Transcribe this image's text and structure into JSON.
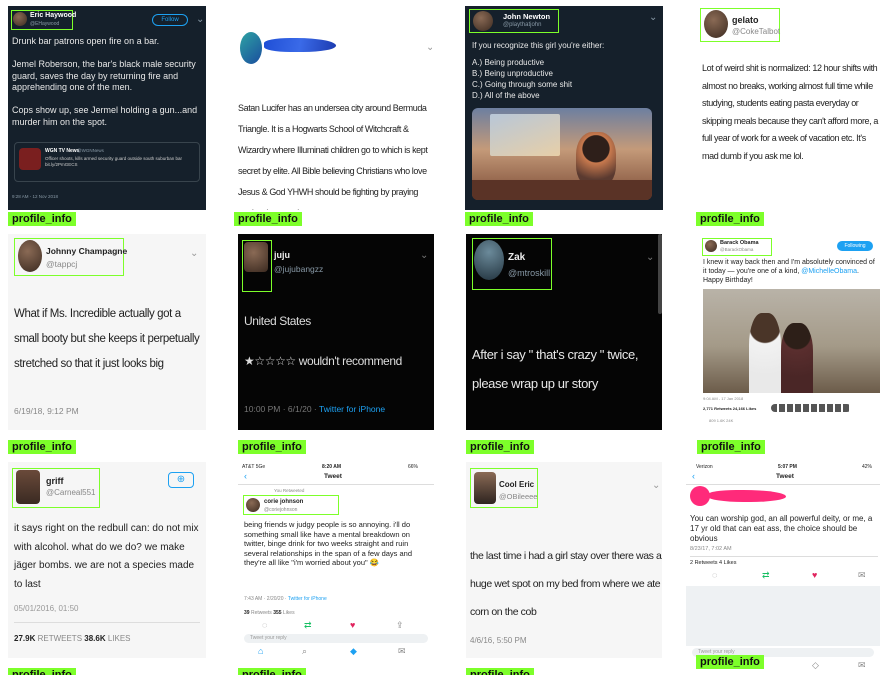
{
  "tag_label": "profile_info",
  "t1": {
    "name": "Eric Haywood",
    "handle": "@EHaywood",
    "follow": "Follow",
    "body": "Drunk bar patrons open fire on a bar.\n\nJemel Roberson, the bar's black male security guard, saves the day by returning fire and apprehending one of the men.\n\nCops show up, see Jermel holding a gun...and murder him on the spot.",
    "quote_source": "WGN TV News",
    "quote_handle": "@WGNNews",
    "quote_text": "Officer shoots, kills armed security guard outside south suburban bar bit.ly/2PmGECS",
    "time": "9:28 AM - 12 Nov 2018"
  },
  "t2": {
    "body": "Satan Lucifer has an undersea city around Bermuda Triangle. It is a Hogwarts School of Witchcraft & Wizardry where Illuminati children go to which is kept secret by elite. All Bible believing Christians who love Jesus & God YHWH should be fighting by praying against it every day."
  },
  "t3": {
    "name": "John Newton",
    "handle": "@playthatjohn",
    "body": "If you recognize this girl you're either:",
    "options": [
      "A.) Being productive",
      "B.) Being unproductive",
      "C.) Going through some shit",
      "D.) All of the above"
    ]
  },
  "t4": {
    "name": "gelato",
    "handle": "@CokeTalbot",
    "body": "Lot of weird shit is normalized: 12 hour shifts with almost no breaks, working almost full time while studying, students eating pasta everyday or skipping meals because they can't afford more, a full year of work for a week of vacation etc. It's mad dumb if you ask me lol."
  },
  "t5": {
    "name": "Johnny Champagne",
    "handle": "@tappcj",
    "body": "What if Ms. Incredible actually got a small booty but she keeps it perpetually stretched so that it just looks big",
    "time": "6/19/18, 9:12 PM"
  },
  "t6": {
    "name": "juju",
    "handle": "@jujubangzz",
    "line1": "United States",
    "line2": "★☆☆☆☆ wouldn't recommend",
    "time": "10:00 PM · 6/1/20 · ",
    "client": "Twitter for iPhone"
  },
  "t7": {
    "name": "Zak",
    "handle": "@mtroskill",
    "body": "After i say \" that's crazy \" twice, please wrap up ur story"
  },
  "t8": {
    "name": "Barack Obama",
    "handle": "@BarackObama",
    "follow": "Following",
    "body": "I knew it way back then and I'm absolutely convinced of it today — you're one of a kind,",
    "mention": "@MichelleObama",
    "body2": ". Happy Birthday!",
    "time": "9:04 AM - 17 Jan 2018",
    "stats": "2,771 Retweets  24,166 Likes",
    "actions": "809    1.6K    24K"
  },
  "t9": {
    "name": "griff",
    "handle": "@Carneal551",
    "body": "it says right on the redbull can: do not mix with alcohol. what do we do? we make jäger bombs. we are not a species made to last",
    "time": "05/01/2016, 01:50",
    "rt_count": "27.9K",
    "rt_label": " RETWEETS  ",
    "like_count": "38.6K",
    "like_label": " LIKES"
  },
  "t10": {
    "carrier": "AT&T 5Ge",
    "clock": "8:20 AM",
    "battery": "66%",
    "header": "Tweet",
    "retweeted": "You Retweeted",
    "name": "corie johnson",
    "handle": "@coriejohnson",
    "body": "being friends w judgy people is so annoying. i'll do something small like have a mental breakdown on twitter, binge drink for two weeks straight and ruin several relationships in the span of a few days and they're all like \"i'm worried about you\" 😂",
    "time": "7:43 AM · 2/20/20 · ",
    "client": "Twitter for iPhone",
    "stats_rt": "39",
    "stats_rt_label": " Retweets  ",
    "stats_like": "355",
    "stats_like_label": " Likes",
    "reply": "Tweet your reply"
  },
  "t11": {
    "name": "Cool Eric",
    "handle": "@OBileeee",
    "body": "the last time i had a girl stay over there was a huge wet spot on my bed from where we ate corn on the cob",
    "time": "4/6/16, 5:50 PM"
  },
  "t12": {
    "carrier": "Verizon",
    "clock": "5:07 PM",
    "battery": "42%",
    "header": "Tweet",
    "body": "You can worship god, an all powerful deity, or me, a 17 yr old that can eat ass, the choice should be obvious",
    "time": "8/23/17, 7:02 AM",
    "stats": "2 Retweets  4 Likes",
    "reply": "Tweet your reply"
  },
  "colors": {
    "tag": "#7dff2a",
    "twitter_blue": "#1da1f2"
  }
}
